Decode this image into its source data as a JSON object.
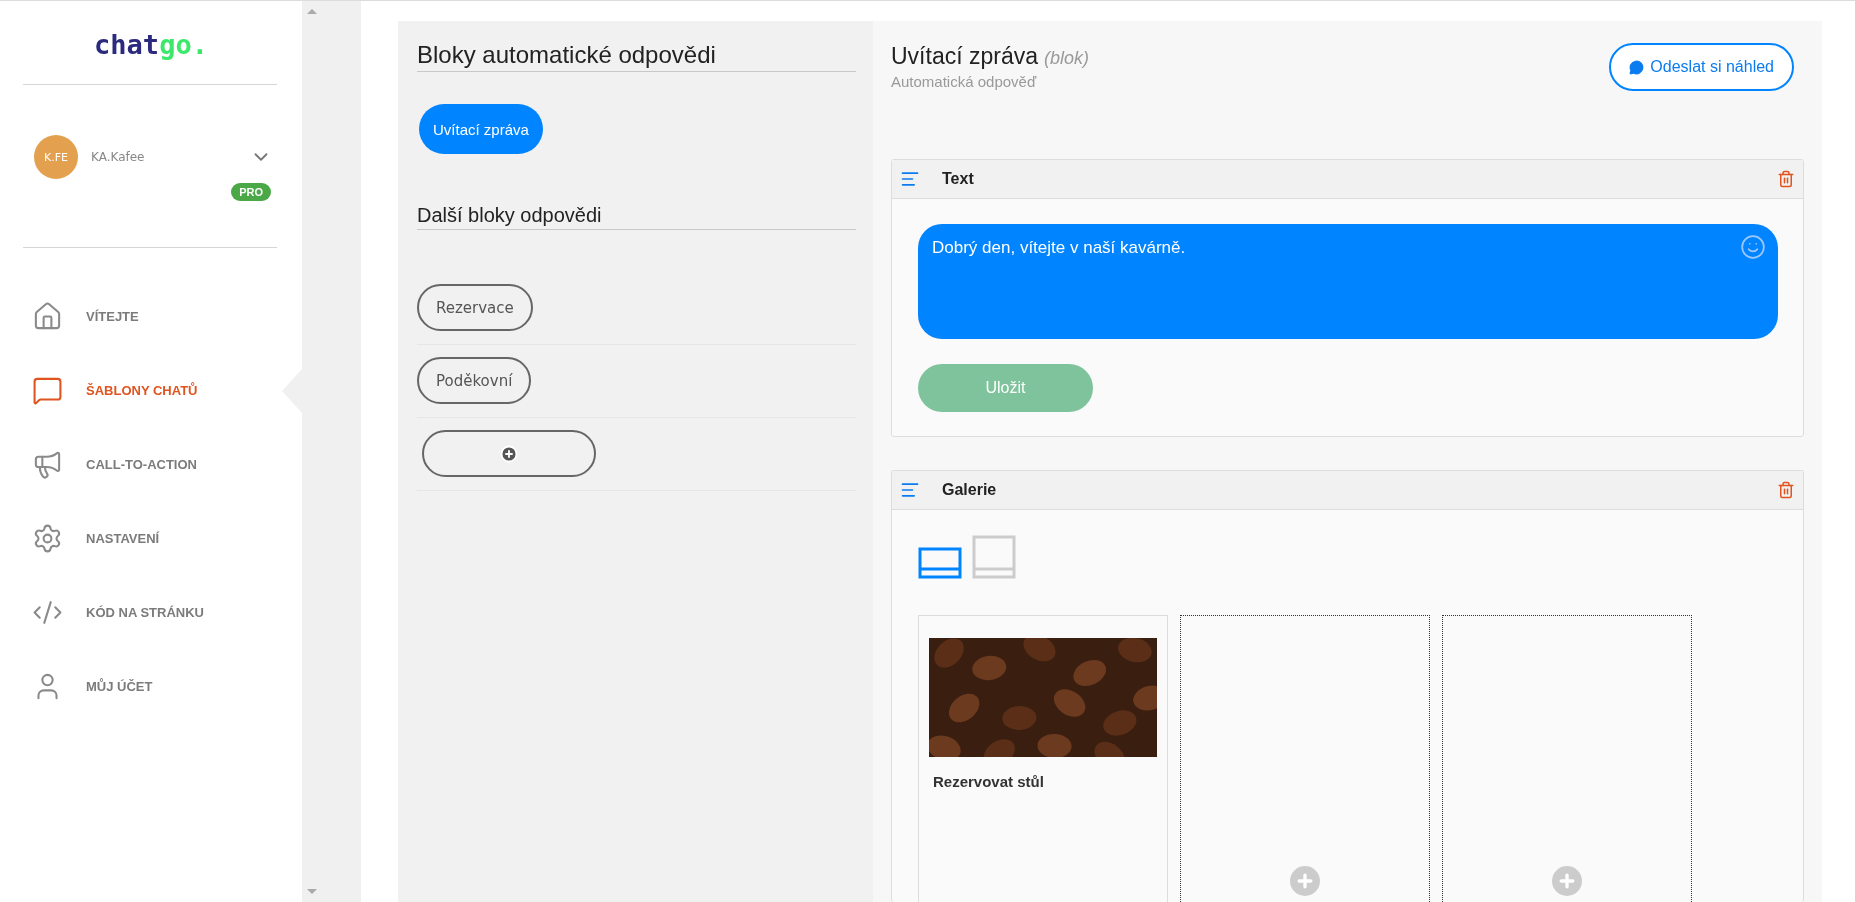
{
  "sidebar": {
    "logo": {
      "part_1": "chat",
      "part_2": "go."
    },
    "account": {
      "initials": "K.FE",
      "name": "KA.Kafee",
      "badge": "PRO"
    },
    "nav": [
      {
        "label": "VÍTEJTE",
        "selected": false
      },
      {
        "label": "ŠABLONY CHATŮ",
        "selected": true
      },
      {
        "label": "CALL-TO-ACTION",
        "selected": false
      },
      {
        "label": "NASTAVENÍ",
        "selected": false
      },
      {
        "label": "KÓD NA STRÁNKU",
        "selected": false
      },
      {
        "label": "MŮJ ÚČET",
        "selected": false
      }
    ]
  },
  "blocks_panel": {
    "title": "Bloky automatické odpovědi",
    "main_blocks": [
      {
        "label": "Uvítací zpráva",
        "selected": true
      }
    ],
    "other_title": "Další bloky odpovědi",
    "other_blocks": [
      {
        "label": "Rezervace",
        "selected": false
      },
      {
        "label": "Poděkovní",
        "selected": false
      }
    ]
  },
  "editor": {
    "title": "Uvítací zpráva",
    "title_note": "(blok)",
    "subtitle": "Automatická odpověď",
    "preview_button": "Odeslat si náhled",
    "cards": [
      {
        "kind": "text",
        "title": "Text",
        "message": "Dobrý den, vítejte v naší kavárně.",
        "save_button": "Uložit"
      },
      {
        "kind": "gallery",
        "title": "Galerie",
        "layouts": [
          {
            "kind": "wide",
            "selected": true
          },
          {
            "kind": "square",
            "selected": false
          }
        ],
        "items": [
          {
            "kind": "card",
            "caption": "Rezervovat stůl"
          },
          {
            "kind": "empty"
          },
          {
            "kind": "empty"
          }
        ]
      }
    ]
  }
}
